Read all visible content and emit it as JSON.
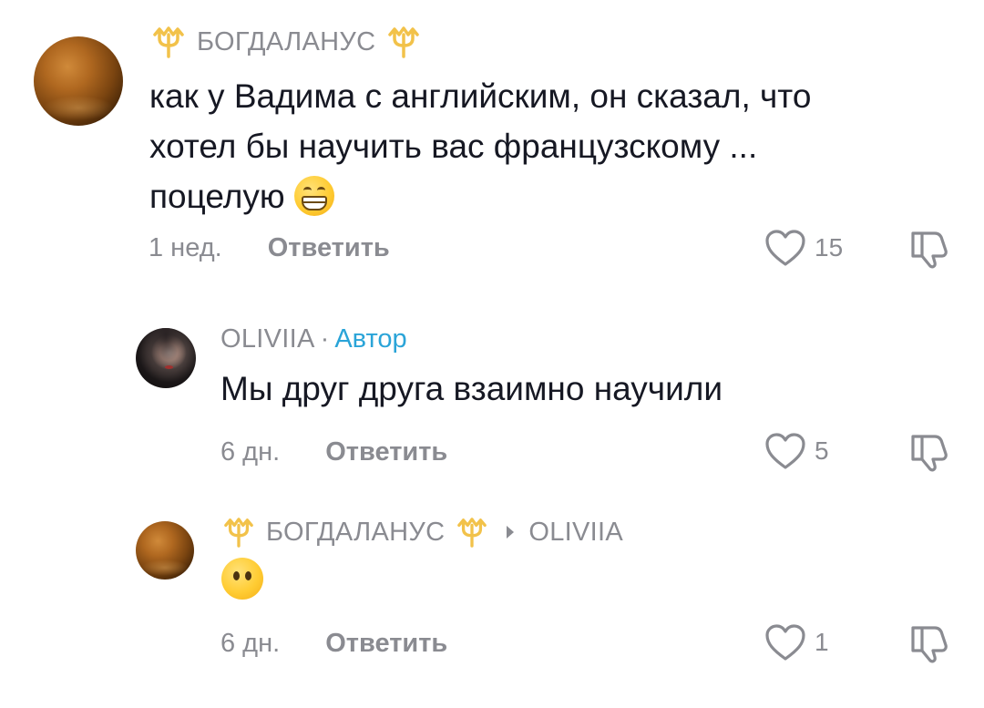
{
  "comments": [
    {
      "author": "БОГДАЛАНУС",
      "author_icon": "trident-icon",
      "text_lines": [
        "как у Вадима с английским, он сказал, что",
        "хотел бы научить вас французскому ...",
        "поцелую"
      ],
      "emoji": "grinning-face-icon",
      "time": "1 нед.",
      "reply_label": "Ответить",
      "likes": "15"
    },
    {
      "author": "OLIVIIA",
      "separator": "·",
      "badge": "Автор",
      "text_lines": [
        "Мы друг друга взаимно научили"
      ],
      "time": "6 дн.",
      "reply_label": "Ответить",
      "likes": "5"
    },
    {
      "author": "БОГДАЛАНУС",
      "author_icon": "trident-icon",
      "reply_to": "OLIVIIA",
      "emoji": "face-without-mouth-icon",
      "time": "6 дн.",
      "reply_label": "Ответить",
      "likes": "1"
    }
  ],
  "colors": {
    "text": "#161823",
    "muted": "#8a8b91",
    "author_badge": "#2aa4d8",
    "trident": "#f2c24a"
  }
}
